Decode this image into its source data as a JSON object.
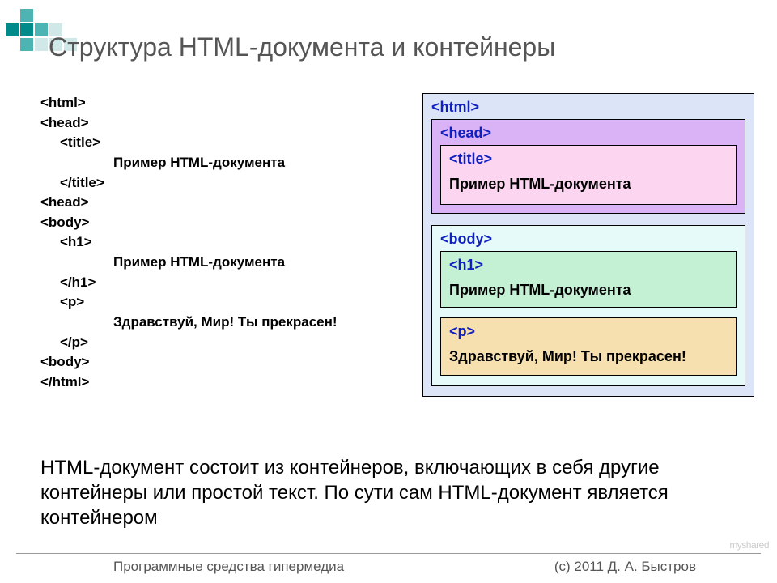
{
  "title": "Структура HTML-документа и контейнеры",
  "code": {
    "l1": "<html>",
    "l2": "<head>",
    "l3": "<title>",
    "l4": "Пример HTML-документа",
    "l5": "</title>",
    "l6": "<head>",
    "l7": "<body>",
    "l8": "<h1>",
    "l9": "Пример HTML-документа",
    "l10": "</h1>",
    "l11": "<p>",
    "l12": "Здравствуй, Мир! Ты прекрасен!",
    "l13": "</p>",
    "l14": "<body>",
    "l15": "</html>"
  },
  "diagram": {
    "html_tag": "<html>",
    "head_tag": "<head>",
    "title_tag": "<title>",
    "title_text": "Пример HTML-документа",
    "body_tag": "<body>",
    "h1_tag": "<h1>",
    "h1_text": "Пример HTML-документа",
    "p_tag": "<p>",
    "p_text": "Здравствуй, Мир! Ты прекрасен!"
  },
  "description": "HTML-документ состоит из контейнеров, включающих в себя другие контейнеры или простой текст. По сути сам HTML-документ является контейнером",
  "footer": {
    "left": "Программные средства гипермедиа",
    "right": "(с) 2011    Д. А. Быстров"
  },
  "watermark": "myshared"
}
